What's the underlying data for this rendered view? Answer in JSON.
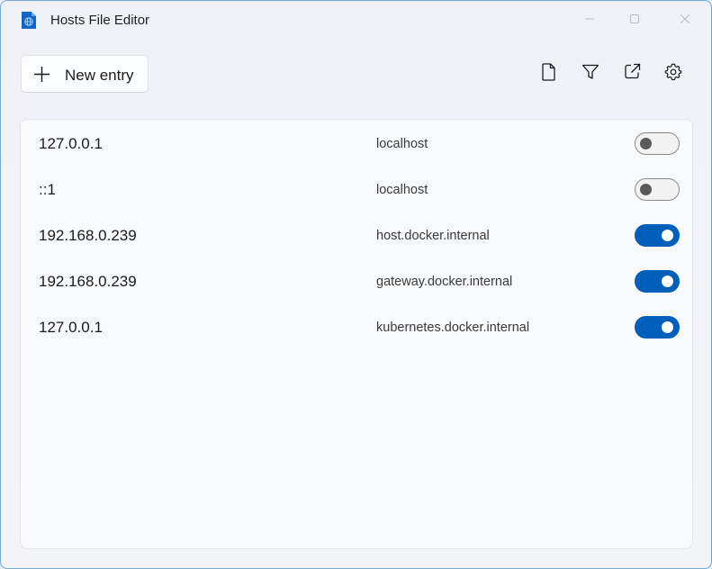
{
  "window": {
    "title": "Hosts File Editor",
    "app_icon": "document-globe-icon",
    "caption_buttons": [
      "minimize-icon",
      "maximize-icon",
      "close-icon"
    ]
  },
  "toolbar": {
    "new_entry_label": "New entry",
    "new_entry_icon": "plus-icon",
    "actions": [
      {
        "name": "open-hosts-file-button",
        "icon": "document-icon"
      },
      {
        "name": "filter-button",
        "icon": "filter-icon"
      },
      {
        "name": "open-external-button",
        "icon": "open-external-icon"
      },
      {
        "name": "settings-button",
        "icon": "gear-icon"
      }
    ]
  },
  "entries": [
    {
      "address": "127.0.0.1",
      "hosts": "localhost",
      "active": false
    },
    {
      "address": "::1",
      "hosts": "localhost",
      "active": false
    },
    {
      "address": "192.168.0.239",
      "hosts": "host.docker.internal",
      "active": true
    },
    {
      "address": "192.168.0.239",
      "hosts": "gateway.docker.internal",
      "active": true
    },
    {
      "address": "127.0.0.1",
      "hosts": "kubernetes.docker.internal",
      "active": true
    }
  ],
  "colors": {
    "accent": "#005fb8",
    "toggle_off_track": "#f2f2f2",
    "toggle_off_knob": "#5a5a5a",
    "window_border": "#7aa8d2"
  }
}
